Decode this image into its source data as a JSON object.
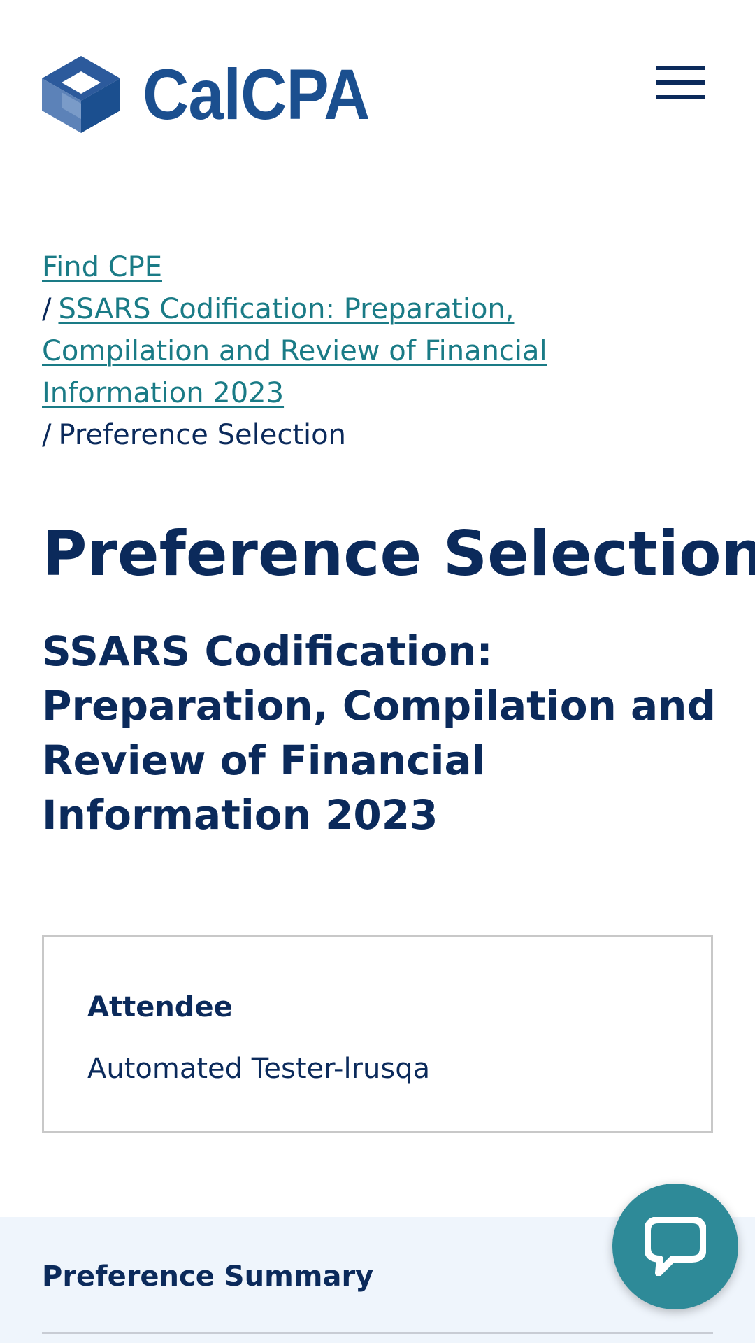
{
  "header": {
    "logo_text": "CalCPA",
    "menu_icon": "hamburger-menu-icon"
  },
  "breadcrumb": {
    "items": [
      {
        "label": "Find CPE",
        "link": true
      },
      {
        "label": "SSARS Codification: Preparation, Compilation and Review of Financial Information 2023",
        "link": true
      },
      {
        "label": "Preference Selection",
        "link": false
      }
    ],
    "separator": "/"
  },
  "page": {
    "title": "Preference Selection",
    "course_title": "SSARS Codification: Preparation, Compilation and Review of Financial Information 2023"
  },
  "attendee": {
    "label": "Attendee",
    "name": "Automated Tester-lrusqa"
  },
  "summary": {
    "title": "Preference Summary"
  },
  "chat": {
    "icon": "chat-bubble-icon"
  },
  "colors": {
    "brand_blue": "#1b4f8f",
    "navy_text": "#0b2a5b",
    "link_teal": "#1a7b86",
    "chat_teal": "#2e8a98",
    "summary_bg": "#eff5fc"
  }
}
